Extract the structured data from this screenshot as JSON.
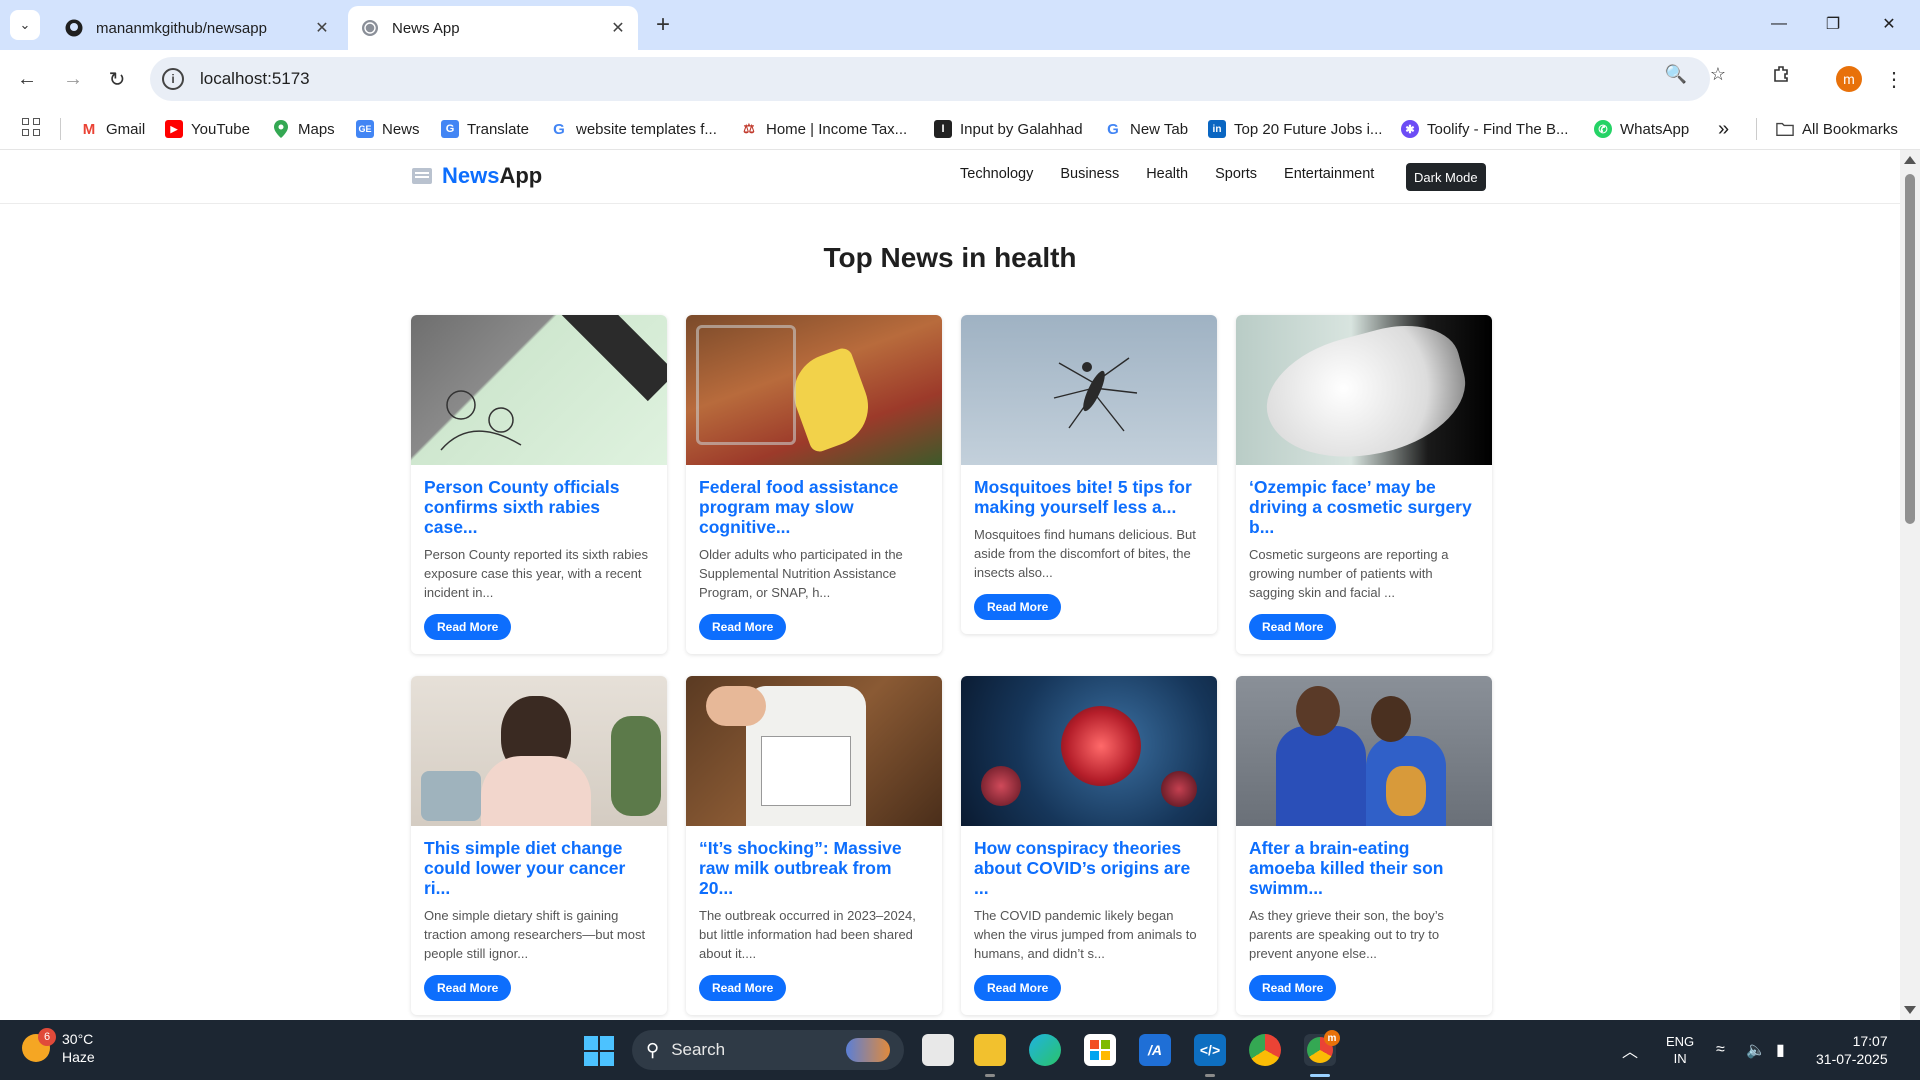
{
  "browser": {
    "tabs": [
      {
        "title": "mananmkgithub/newsapp",
        "icon": "github-icon"
      },
      {
        "title": "News App",
        "icon": "globe-icon"
      }
    ],
    "url": "localhost:5173",
    "profile_initial": "m",
    "bookmarks": [
      {
        "label": "Gmail",
        "icon": "gmail-icon",
        "color": "#ea4335"
      },
      {
        "label": "YouTube",
        "icon": "youtube-icon",
        "color": "#ff0000"
      },
      {
        "label": "Maps",
        "icon": "maps-icon",
        "color": "#34a853"
      },
      {
        "label": "News",
        "icon": "google-news-icon",
        "color": "#4285f4"
      },
      {
        "label": "Translate",
        "icon": "translate-icon",
        "color": "#4285f4"
      },
      {
        "label": "website templates f...",
        "icon": "google-icon",
        "color": "#4285f4"
      },
      {
        "label": "Home | Income Tax...",
        "icon": "income-tax-icon",
        "color": "#c0392b"
      },
      {
        "label": "Input by Galahhad",
        "icon": "galahhad-icon",
        "color": "#222222"
      },
      {
        "label": "New Tab",
        "icon": "google-icon",
        "color": "#4285f4"
      },
      {
        "label": "Top 20 Future Jobs i...",
        "icon": "linkedin-icon",
        "color": "#0a66c2"
      },
      {
        "label": "Toolify - Find The B...",
        "icon": "toolify-icon",
        "color": "#6c4cf5"
      },
      {
        "label": "WhatsApp",
        "icon": "whatsapp-icon",
        "color": "#25d366"
      }
    ],
    "more_bookmarks": "»",
    "all_bookmarks": "All Bookmarks"
  },
  "site": {
    "brand_news": "News",
    "brand_app": "App",
    "nav": [
      "Technology",
      "Business",
      "Health",
      "Sports",
      "Entertainment"
    ],
    "dark_mode_label": "Dark Mode",
    "heading": "Top News in health",
    "read_more": "Read More",
    "articles": [
      {
        "title": "Person County officials confirms sixth rabies case...",
        "desc": "Person County reported its sixth rabies exposure case this year, with a recent incident in...",
        "image": "rabies-pamphlet-image"
      },
      {
        "title": "Federal food assistance program may slow cognitive...",
        "desc": "Older adults who participated in the Supplemental Nutrition Assistance Program, or SNAP, h...",
        "image": "grocery-basket-image"
      },
      {
        "title": "Mosquitoes bite! 5 tips for making yourself less a...",
        "desc": "Mosquitoes find humans delicious. But aside from the discomfort of bites, the insects also...",
        "image": "mosquito-image"
      },
      {
        "title": "‘Ozempic face’ may be driving a cosmetic surgery b...",
        "desc": "Cosmetic surgeons are reporting a growing number of patients with sagging skin and facial ...",
        "image": "face-sculpture-image"
      },
      {
        "title": "This simple diet change could lower your cancer ri...",
        "desc": "One simple dietary shift is gaining traction among researchers—but most people still ignor...",
        "image": "woman-headache-image"
      },
      {
        "title": "“It’s shocking”: Massive raw milk outbreak from 20...",
        "desc": "The outbreak occurred in 2023–2024, but little information had been shared about it....",
        "image": "raw-milk-jug-image"
      },
      {
        "title": "How conspiracy theories about COVID’s origins are ...",
        "desc": "The COVID pandemic likely began when the virus jumped from animals to humans, and didn’t s...",
        "image": "virus-image"
      },
      {
        "title": "After a brain-eating amoeba killed their son swimm...",
        "desc": "As they grieve their son, the boy’s parents are speaking out to try to prevent anyone else...",
        "image": "grieving-parents-image"
      }
    ]
  },
  "taskbar": {
    "weather_badge": "6",
    "temperature": "30°C",
    "condition": "Haze",
    "search_label": "Search",
    "lang_top": "ENG",
    "lang_bottom": "IN",
    "time": "17:07",
    "date": "31-07-2025",
    "chrome_badge": "m"
  },
  "colors": {
    "accent": "#0d6efd",
    "dark_button": "#212529",
    "tabstrip": "#d3e3fd",
    "taskbar": "#1c2632"
  }
}
